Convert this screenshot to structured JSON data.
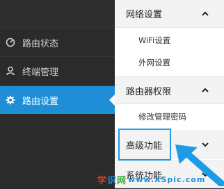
{
  "sidebar": {
    "items": [
      {
        "label": "路由状态",
        "icon": "gauge-icon"
      },
      {
        "label": "终端管理",
        "icon": "user-icon"
      },
      {
        "label": "路由设置",
        "icon": "gear-icon",
        "active": true
      }
    ]
  },
  "panel": {
    "sections": [
      {
        "title": "网络设置",
        "expanded": true,
        "items": [
          "WiFi设置",
          "外网设置"
        ]
      },
      {
        "title": "路由器权限",
        "expanded": true,
        "items": [
          "修改管理密码"
        ]
      },
      {
        "title": "高级功能",
        "expanded": false,
        "items": []
      },
      {
        "title": "系统功能",
        "expanded": false,
        "items": []
      }
    ]
  },
  "annotation": {
    "highlight_color": "#1e9be6"
  },
  "watermark": {
    "part1": "学",
    "part2": "识",
    "part3": "网",
    "domain": "www.XSpic.com"
  }
}
